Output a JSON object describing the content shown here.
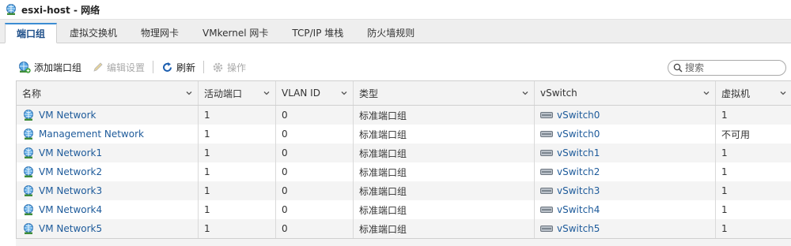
{
  "window": {
    "title": "esxi-host - 网络"
  },
  "tabs": [
    {
      "label": "端口组",
      "active": true
    },
    {
      "label": "虚拟交换机",
      "active": false
    },
    {
      "label": "物理网卡",
      "active": false
    },
    {
      "label": "VMkernel 网卡",
      "active": false
    },
    {
      "label": "TCP/IP 堆栈",
      "active": false
    },
    {
      "label": "防火墙规则",
      "active": false
    }
  ],
  "toolbar": {
    "add_label": "添加端口组",
    "edit_label": "编辑设置",
    "refresh_label": "刷新",
    "actions_label": "操作"
  },
  "search": {
    "placeholder": "搜索"
  },
  "columns": [
    "名称",
    "活动端口",
    "VLAN ID",
    "类型",
    "vSwitch",
    "虚拟机"
  ],
  "rows": [
    {
      "name": "VM Network",
      "active_ports": "1",
      "vlan": "0",
      "type": "标准端口组",
      "vswitch": "vSwitch0",
      "vms": "1"
    },
    {
      "name": "Management Network",
      "active_ports": "1",
      "vlan": "0",
      "type": "标准端口组",
      "vswitch": "vSwitch0",
      "vms": "不可用"
    },
    {
      "name": "VM Network1",
      "active_ports": "1",
      "vlan": "0",
      "type": "标准端口组",
      "vswitch": "vSwitch1",
      "vms": "1"
    },
    {
      "name": "VM Network2",
      "active_ports": "1",
      "vlan": "0",
      "type": "标准端口组",
      "vswitch": "vSwitch2",
      "vms": "1"
    },
    {
      "name": "VM Network3",
      "active_ports": "1",
      "vlan": "0",
      "type": "标准端口组",
      "vswitch": "vSwitch3",
      "vms": "1"
    },
    {
      "name": "VM Network4",
      "active_ports": "1",
      "vlan": "0",
      "type": "标准端口组",
      "vswitch": "vSwitch4",
      "vms": "1"
    },
    {
      "name": "VM Network5",
      "active_ports": "1",
      "vlan": "0",
      "type": "标准端口组",
      "vswitch": "vSwitch5",
      "vms": "1"
    }
  ],
  "colors": {
    "link": "#1d5a9a",
    "accent": "#3b8dd3"
  },
  "icons": {
    "title": "network-globe-icon",
    "add": "add-portgroup-icon",
    "edit": "pencil-icon",
    "refresh": "refresh-icon",
    "actions": "gear-icon",
    "search": "search-icon",
    "row": "network-globe-icon",
    "vswitch": "vswitch-icon"
  }
}
